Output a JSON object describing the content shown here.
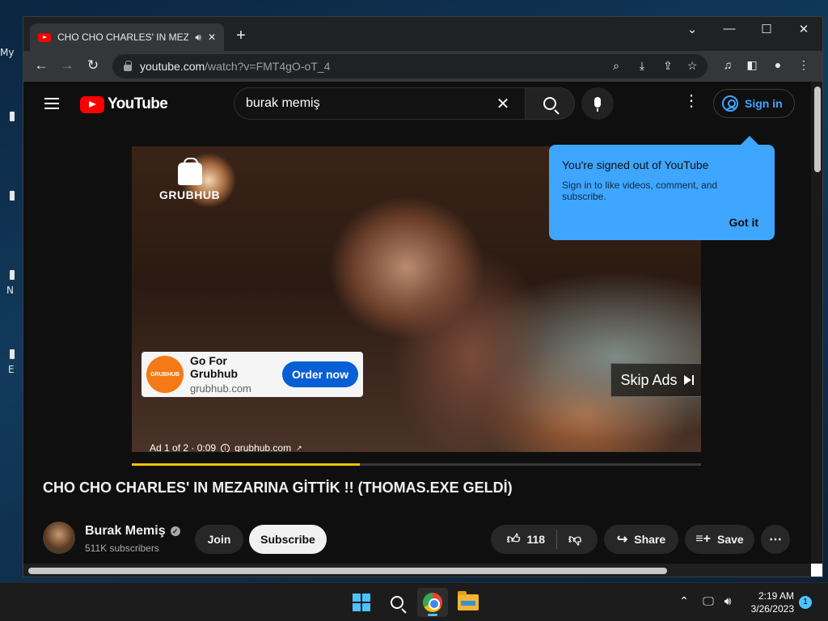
{
  "desktop": {
    "frag1": "My",
    "frag2": "N",
    "frag3": "E"
  },
  "browser": {
    "tab_title": "CHO CHO CHARLES' IN MEZARINA GİTTİK !! (THOMAS.EXE GELDİ) - YouTube",
    "url_host": "youtube.com",
    "url_path": "/watch?v=FMT4gO-oT_4"
  },
  "youtube": {
    "logo_text": "YouTube",
    "search_value": "burak memiş",
    "signin_label": "Sign in",
    "tooltip": {
      "title": "You're signed out of YouTube",
      "body": "Sign in to like videos, comment, and subscribe.",
      "button": "Got it"
    },
    "ad": {
      "brand_logo_text": "GRUBHUB",
      "card_logo_text": "GRUBHUB",
      "name": "Go For Grubhub",
      "domain": "grubhub.com",
      "cta": "Order now",
      "skip": "Skip Ads",
      "info": "Ad 1 of 2 · 0:09",
      "info_domain": "grubhub.com",
      "progress_fraction": 0.4
    },
    "video": {
      "title": "CHO CHO CHARLES' IN MEZARINA GİTTİK !! (THOMAS.EXE GELDİ)",
      "channel": "Burak Memiş",
      "subscribers": "511K subscribers",
      "join": "Join",
      "subscribe": "Subscribe",
      "likes": "118",
      "share": "Share",
      "save": "Save"
    }
  },
  "taskbar": {
    "time": "2:19 AM",
    "date": "3/26/2023",
    "notification_count": "1"
  },
  "colors": {
    "accent_blue": "#3ea6ff",
    "youtube_red": "#ff0000",
    "ad_cta": "#065fd4",
    "ad_progress": "#f7c300",
    "grubhub_orange": "#f47a17"
  }
}
